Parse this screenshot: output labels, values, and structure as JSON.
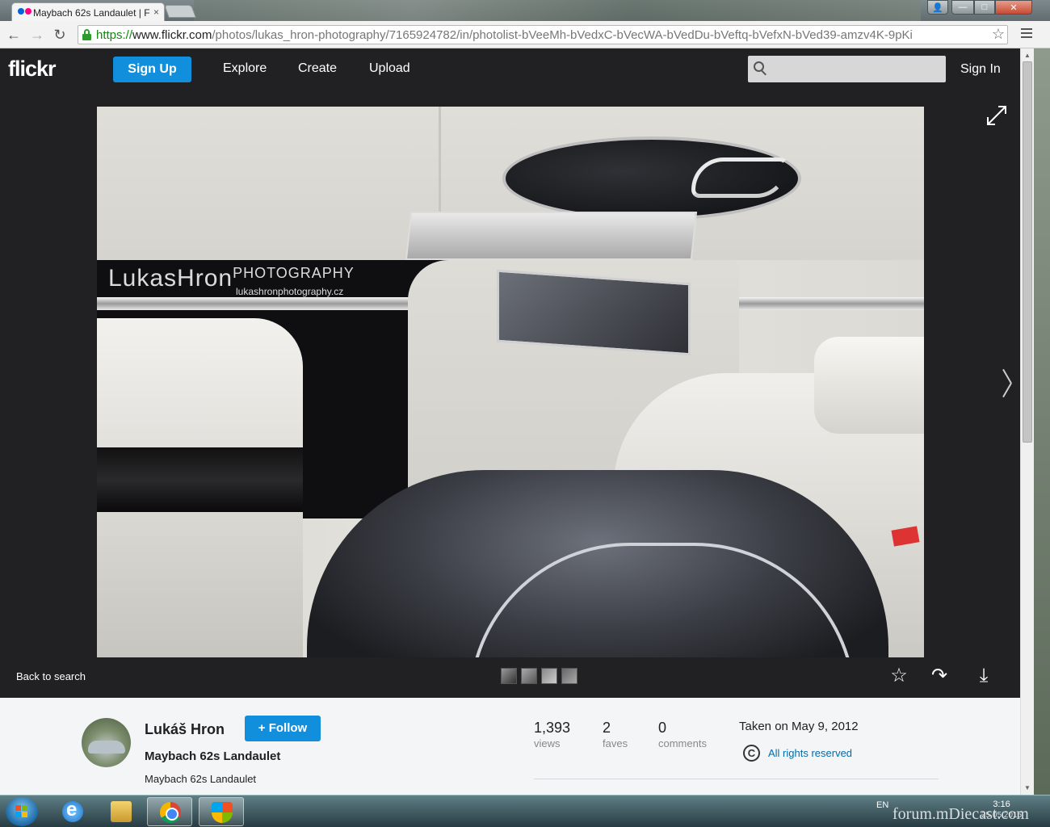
{
  "browser": {
    "tab_title": "Maybach 62s Landaulet | F",
    "url_scheme": "https://",
    "url_host": "www.flickr.com",
    "url_path": "/photos/lukas_hron-photography/7165924782/in/photolist-bVeeMh-bVedxC-bVecWA-bVedDu-bVeftq-bVefxN-bVed39-amzv4K-9pKi",
    "back_glyph": "←",
    "forward_glyph": "→",
    "reload_glyph": "↻",
    "star_glyph": "☆",
    "tab_close_glyph": "×",
    "window_close_glyph": "✕",
    "window_max_glyph": "□",
    "window_min_glyph": "—",
    "user_glyph": "👤"
  },
  "header": {
    "logo": "flickr",
    "signup_label": "Sign Up",
    "nav": [
      "Explore",
      "Create",
      "Upload"
    ],
    "search_value": "",
    "signin_label": "Sign In"
  },
  "photo": {
    "watermark_name": "LukasHron",
    "watermark_photography": "PHOTOGRAPHY",
    "watermark_site": "lukashronphotography.cz"
  },
  "stage": {
    "back_to_search": "Back to search",
    "fave_glyph": "☆",
    "share_glyph": "↷",
    "download_glyph": "⤓"
  },
  "info": {
    "owner_name": "Lukáš Hron",
    "follow_label": "+ Follow",
    "title": "Maybach 62s Landaulet",
    "description": "Maybach 62s Landaulet",
    "stats": [
      {
        "num": "1,393",
        "label": "views"
      },
      {
        "num": "2",
        "label": "faves"
      },
      {
        "num": "0",
        "label": "comments"
      }
    ],
    "taken": "Taken on May 9, 2012",
    "rights_glyph": "C",
    "rights": "All rights reserved"
  },
  "taskbar": {
    "tray": "EN",
    "time": "3:16",
    "date": "25.05.2015",
    "watermark": "forum.mDiecast.com"
  },
  "scrollbar": {
    "up_glyph": "▲",
    "down_glyph": "▼"
  }
}
